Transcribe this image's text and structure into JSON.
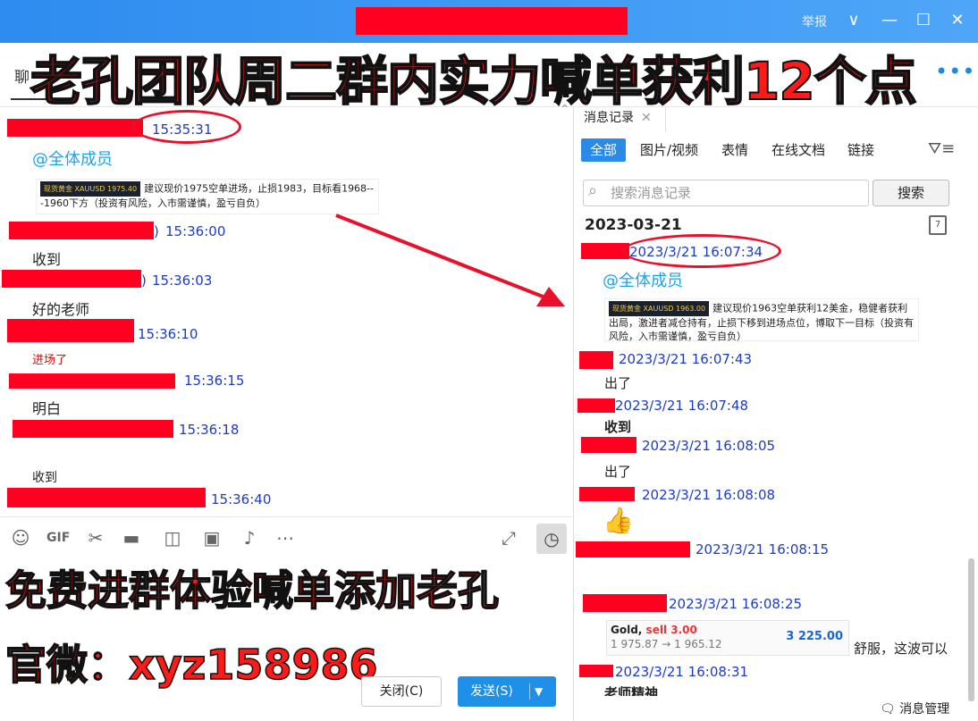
{
  "titlebar": {
    "report_label": "举报",
    "minimize": "—",
    "maximize": "☐",
    "close": "✕",
    "dropdown": "∨"
  },
  "tabs": {
    "first_label": "聊"
  },
  "headline": "老孔团队周二群内实力喊单获利12个点",
  "left_chat": {
    "messages": [
      {
        "time": "15:35:31"
      },
      {
        "mention": "@全体成员",
        "card_text": "建议现价1975空单进场，止损1983，目标看1968---1960下方（投资有风险，入市需谨慎，盈亏自负）",
        "card_chip": "现货黄金 XAUUSD 1975.40"
      },
      {
        "time": "15:36:00",
        "text": "收到"
      },
      {
        "time": "15:36:03",
        "text": "好的老师"
      },
      {
        "time": "15:36:10",
        "text": "进场了"
      },
      {
        "time": "15:36:15",
        "text": "明白"
      },
      {
        "time": "15:36:18",
        "text": "收到"
      },
      {
        "time": "15:36:40"
      }
    ]
  },
  "promo": {
    "line1": "免费进群体验喊单添加老孔",
    "line2": "官微：xyz158986"
  },
  "buttons": {
    "close": "关闭(C)",
    "send": "发送(S)"
  },
  "right_panel": {
    "tab_title": "消息记录",
    "filters": [
      "全部",
      "图片/视频",
      "表情",
      "在线文档",
      "链接"
    ],
    "search_placeholder": "搜索消息记录",
    "search_button": "搜索",
    "date": "2023-03-21",
    "calendar_day": "7",
    "messages": [
      {
        "time": "2023/3/21 16:07:34"
      },
      {
        "mention": "@全体成员",
        "card_text": "建议现价1963空单获利12美金，稳健者获利出局，激进者减仓持有，止损下移到进场点位，博取下一目标（投资有风险，入市需谨慎，盈亏自负）",
        "card_chip": "现货黄金 XAUUSD 1963.00"
      },
      {
        "time": "2023/3/21 16:07:43",
        "text": "出了"
      },
      {
        "time": "2023/3/21 16:07:48",
        "text": "收到"
      },
      {
        "time": "2023/3/21 16:08:05",
        "text": "出了"
      },
      {
        "time": "2023/3/21 16:08:08",
        "text": "👍"
      },
      {
        "time": "2023/3/21 16:08:15"
      },
      {
        "time": "2023/3/21 16:08:25",
        "text": "舒服，这波可以"
      },
      {
        "time": "2023/3/21 16:08:31",
        "text": "老师精神"
      }
    ],
    "gold_card": {
      "name": "Gold, ",
      "action": "sell 3.00",
      "prices": "1 975.87 → 1 965.12",
      "profit": "3 225.00"
    },
    "manage_label": "消息管理"
  }
}
